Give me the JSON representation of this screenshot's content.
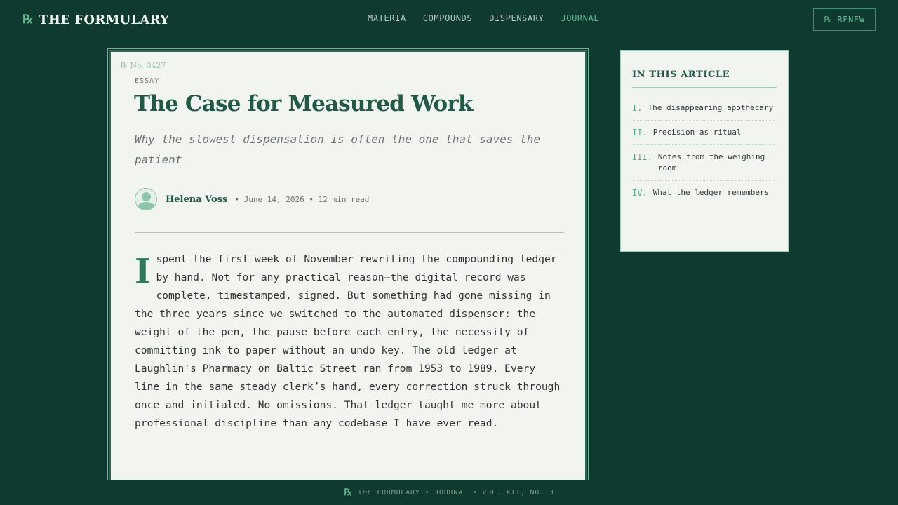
{
  "header": {
    "brand_mark": "℞",
    "brand_name": "THE FORMULARY",
    "nav": [
      {
        "label": "MATERIA"
      },
      {
        "label": "COMPOUNDS"
      },
      {
        "label": "DISPENSARY"
      },
      {
        "label": "JOURNAL",
        "active": true
      }
    ],
    "renew_label": "℞ RENEW"
  },
  "article": {
    "rx_number": "℞ No. 0427",
    "kicker": "ESSAY",
    "title": "The Case for Measured Work",
    "subtitle": "Why the slowest dispensation is often the one that saves the patient",
    "author": "Helena Voss",
    "meta": "• June 14, 2026 • 12 min read",
    "dropcap": "I",
    "body": " spent the first week of November rewriting the compounding ledger by hand. Not for any practical reason—the digital record was complete, timestamped, signed. But something had gone missing in the three years since we switched to the automated dispenser: the weight of the pen, the pause before each entry, the necessity of committing ink to paper without an undo key. The old ledger at Laughlin's Pharmacy on Baltic Street ran from 1953 to 1989. Every line in the same steady clerk’s hand, every correction struck through once and initialed. No omissions. That ledger taught me more about professional discipline than any codebase I have ever read."
  },
  "toc": {
    "title": "IN THIS ARTICLE",
    "items": [
      {
        "num": "I.",
        "label": "The disappearing apothecary"
      },
      {
        "num": "II.",
        "label": "Precision as ritual"
      },
      {
        "num": "III.",
        "label": "Notes from the weighing room"
      },
      {
        "num": "IV.",
        "label": "What the ledger remembers"
      }
    ]
  },
  "footer": {
    "mark": "℞",
    "text": "THE FORMULARY • JOURNAL • VOL. XII, NO. 3"
  },
  "colors": {
    "background": "#0f3a2f",
    "accent": "#5fb88e",
    "title": "#1f5a44",
    "paper": "#f2f4ef"
  }
}
